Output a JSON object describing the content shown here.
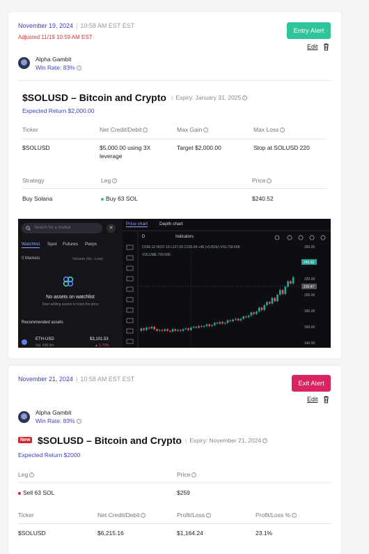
{
  "alert1": {
    "date": "November 19, 2024",
    "time": "10:58 AM EST EST",
    "adjusted": "Adjusted 11/19 10:59 AM EST",
    "button": "Entry Alert",
    "button_color": "#2fc49a",
    "edit": "Edit",
    "author": "Alpha Gambit",
    "win_rate": "Win Rate: 83%",
    "title": "$SOLUSD – Bitcoin and Crypto",
    "expiry": "Expiry: January 31, 2025",
    "expected_return": "Expected Return $2,000.00",
    "table1": {
      "headers": [
        "Ticker",
        "Net Credit/Debit",
        "Max Gain",
        "Max Loss"
      ],
      "row": [
        "$SOLUSD",
        "$5,000.00 using 3X leverage",
        "Target $2,000.00",
        "Stop at SOLUSD 220"
      ]
    },
    "table2": {
      "headers": [
        "Strategy",
        "Leg",
        "Price"
      ],
      "row": [
        "Buy Solana",
        "Buy 63 SOL",
        "$240.52"
      ],
      "leg_dot_color": "#2fc49a"
    },
    "screenshot": {
      "search_placeholder": "Search for a market",
      "close": "✕",
      "tabs": [
        "Watchlist",
        "Spot",
        "Futures",
        "Perps"
      ],
      "markets": "0 Markets",
      "sort": "Volume (Hi - Low)",
      "empty_title": "No assets on watchlist",
      "empty_sub": "Start adding assets to track the price",
      "recommended": "Recommended assets",
      "asset_name": "ETH-USD",
      "asset_vol": "Vol. 438.9m",
      "asset_price": "$3,101.53",
      "asset_change": "▲ 1.75%",
      "chart_tabs": [
        "Price chart",
        "Depth chart"
      ],
      "interval": "D",
      "indicators": "Indicators",
      "ohlc": "O190.12 H237.10 L127.00 C235.09 +46 (+5.81%) VOL739.56K",
      "volume_label": "VOLUME 739.56K",
      "price_ticks": [
        "260.00",
        "240.00",
        "220.00",
        "200.00",
        "180.00",
        "160.00",
        "140.00"
      ],
      "price_tag": "240.92",
      "cross_tag": "210.47",
      "up_color": "#26a69a",
      "down_color": "#ef5350"
    }
  },
  "alert2": {
    "date": "November 21, 2024",
    "time": "10:58 AM EST EST",
    "button": "Exit Alert",
    "button_color": "#d9245f",
    "edit": "Edit",
    "author": "Alpha Gambit",
    "win_rate": "Win Rate: 83%",
    "new_badge": "New",
    "title": "$SOLUSD – Bitcoin and Crypto",
    "expiry": "Expiry: November 21, 2024",
    "expected_return": "Expected Return $2000",
    "table1": {
      "headers": [
        "Leg",
        "Price"
      ],
      "row": [
        "Sell 63 SOL",
        "$259"
      ],
      "leg_dot_color": "#d0262b"
    },
    "table2": {
      "headers": [
        "Ticker",
        "Net Credit/Debit",
        "Profit/Loss",
        "Profit/Loss %"
      ],
      "row": [
        "$SOLUSD",
        "$6,215.16",
        "$1,164.24",
        "23.1%"
      ]
    }
  }
}
